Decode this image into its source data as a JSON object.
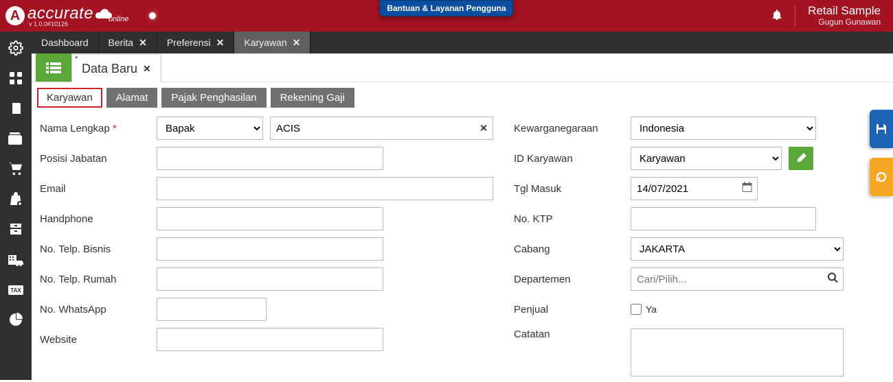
{
  "header": {
    "brand": "accurate",
    "brand_suffix": "online",
    "version": "v 1.0.0#10126",
    "help_label": "Bantuan & Layanan Pengguna",
    "company": "Retail Sample",
    "user": "Gugun Gunawan"
  },
  "main_tabs": [
    {
      "label": "Dashboard",
      "closable": false
    },
    {
      "label": "Berita",
      "closable": true
    },
    {
      "label": "Preferensi",
      "closable": true
    },
    {
      "label": "Karyawan",
      "closable": true,
      "active": true
    }
  ],
  "sub_tabs": {
    "data_baru": "Data Baru"
  },
  "form_tabs": [
    "Karyawan",
    "Alamat",
    "Pajak Penghasilan",
    "Rekening Gaji"
  ],
  "labels": {
    "nama": "Nama Lengkap",
    "posisi": "Posisi Jabatan",
    "email": "Email",
    "hp": "Handphone",
    "telp_bisnis": "No. Telp. Bisnis",
    "telp_rumah": "No. Telp. Rumah",
    "wa": "No. WhatsApp",
    "website": "Website",
    "kewarganegaraan": "Kewarganegaraan",
    "id_karyawan": "ID Karyawan",
    "tgl_masuk": "Tgl Masuk",
    "ktp": "No. KTP",
    "cabang": "Cabang",
    "departemen": "Departemen",
    "penjual": "Penjual",
    "catatan": "Catatan",
    "penjual_ya": "Ya"
  },
  "values": {
    "salutation": "Bapak",
    "nama": "ACIS",
    "posisi": "",
    "email": "",
    "hp": "",
    "telp_bisnis": "",
    "telp_rumah": "",
    "wa": "",
    "website": "",
    "kewarganegaraan": "Indonesia",
    "id_karyawan": "Karyawan",
    "tgl_masuk": "14/07/2021",
    "ktp": "",
    "cabang": "JAKARTA",
    "departemen_placeholder": "Cari/Pilih...",
    "penjual": false,
    "catatan": ""
  }
}
